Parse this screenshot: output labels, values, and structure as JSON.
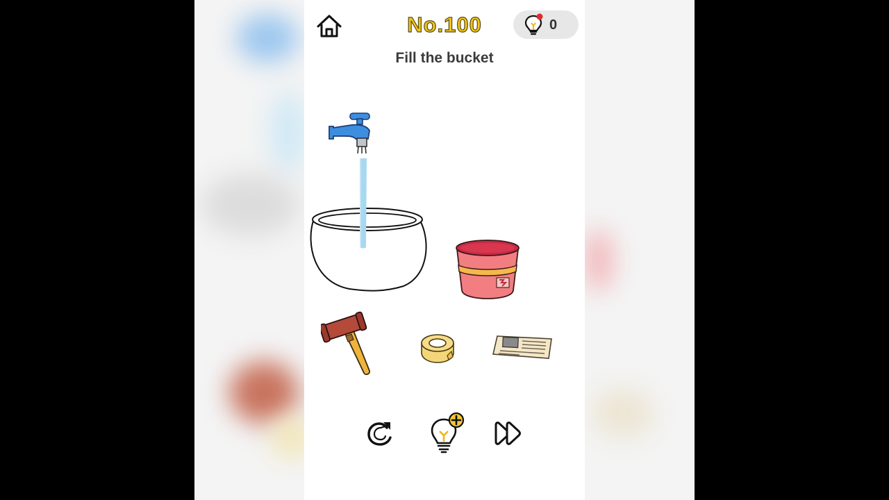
{
  "header": {
    "home_icon": "home-icon",
    "level_title": "No.100",
    "hint_icon": "lightbulb-icon",
    "hint_count": "0"
  },
  "task": {
    "instruction": "Fill the bucket"
  },
  "scene": {
    "objects": [
      "faucet",
      "water-stream",
      "glass-bowl",
      "red-bucket",
      "hammer",
      "tape-roll",
      "newspaper"
    ]
  },
  "controls": {
    "restart_icon": "restart-icon",
    "hint_icon": "lightbulb-plus-icon",
    "skip_icon": "fast-forward-icon"
  },
  "colors": {
    "level_title": "#f1c61a",
    "water": "#a8d8f0",
    "faucet": "#3e8ee0",
    "bucket": "#e8566a",
    "hammer_head": "#b44a3a",
    "tape": "#f4d67a"
  }
}
